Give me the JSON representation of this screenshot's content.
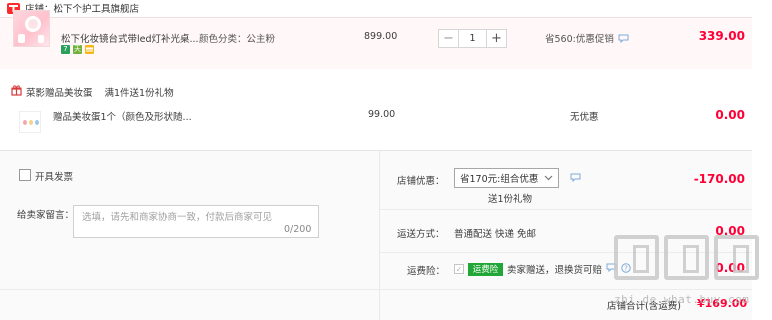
{
  "store": {
    "badge_icon": "tmall-icon",
    "name": "店铺：松下个护工具旗舰店"
  },
  "item": {
    "title": "松下化妆镜台式带led灯补光桌...",
    "option": "颜色分类：公主粉",
    "unit_price": "899.00",
    "quantity": "1",
    "promo": "省560:优惠促销",
    "subtotal": "339.00",
    "tags": [
      {
        "label": "7",
        "color": "#2aa05a"
      },
      {
        "label": "天",
        "color": "#73b13a"
      },
      {
        "label": "",
        "color": "#f5b61b"
      }
    ]
  },
  "gift": {
    "header": "菜影赠品美妆蛋",
    "rule": "满1件送1份礼物",
    "title": "赠品美妆蛋1个（颜色及形状随...",
    "price": "99.00",
    "promo": "无优惠",
    "subtotal": "0.00"
  },
  "invoice": {
    "label": "开具发票"
  },
  "message": {
    "label": "给卖家留言：",
    "placeholder": "选填，请先和商家协商一致，付款后商家可见",
    "counter": "0/200"
  },
  "store_discount": {
    "label": "店铺优惠：",
    "selected": "省170元:组合优惠",
    "note": "送1份礼物",
    "amount": "-170.00"
  },
  "shipping": {
    "label": "运送方式：",
    "method": "普通配送 快递 免邮",
    "amount": "0.00"
  },
  "insurance": {
    "label": "运费险：",
    "badge": "运费险",
    "description": "卖家赠送，退换货可赔",
    "amount": "0.00"
  },
  "total": {
    "label": "店铺合计(含运费)",
    "amount": "¥169.00"
  },
  "watermark": {
    "text": "zhi.de.what.buy.com"
  },
  "colors": {
    "accent_red": "#ff0036",
    "item_bg": "#fff7f8",
    "insurance_green": "#22a637"
  }
}
